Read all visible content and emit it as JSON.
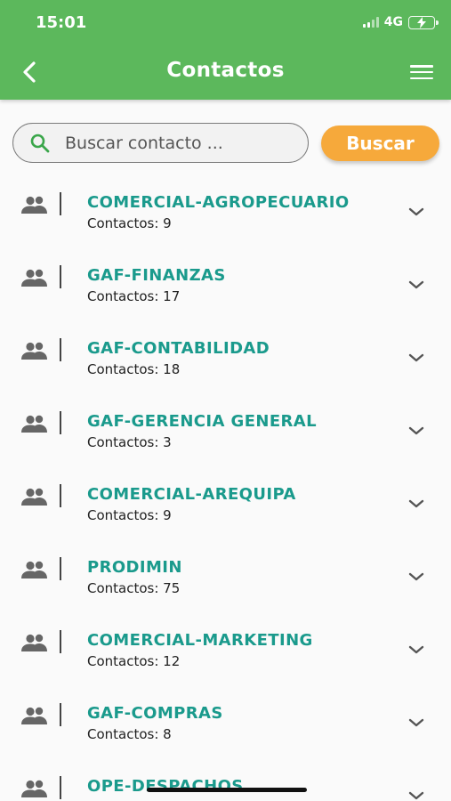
{
  "status_bar": {
    "time": "15:01",
    "network": "4G"
  },
  "header": {
    "title": "Contactos"
  },
  "search": {
    "placeholder": "Buscar contacto ...",
    "button_label": "Buscar"
  },
  "colors": {
    "primary": "#5cb85c",
    "accent": "#f6a93b",
    "group_name": "#1a9a8c"
  },
  "icons": {
    "back": "back-arrow-icon",
    "menu": "hamburger-menu-icon",
    "search": "search-icon",
    "group": "group-icon",
    "expand": "chevron-down-icon"
  },
  "groups": [
    {
      "name": "COMERCIAL-AGROPECUARIO",
      "count": "Contactos: 9"
    },
    {
      "name": "GAF-FINANZAS",
      "count": "Contactos: 17"
    },
    {
      "name": "GAF-CONTABILIDAD",
      "count": "Contactos: 18"
    },
    {
      "name": "GAF-GERENCIA GENERAL",
      "count": "Contactos: 3"
    },
    {
      "name": "COMERCIAL-AREQUIPA",
      "count": "Contactos: 9"
    },
    {
      "name": "PRODIMIN",
      "count": "Contactos: 75"
    },
    {
      "name": "COMERCIAL-MARKETING",
      "count": "Contactos: 12"
    },
    {
      "name": "GAF-COMPRAS",
      "count": "Contactos: 8"
    },
    {
      "name": "OPE-DESPACHOS",
      "count": ""
    }
  ]
}
